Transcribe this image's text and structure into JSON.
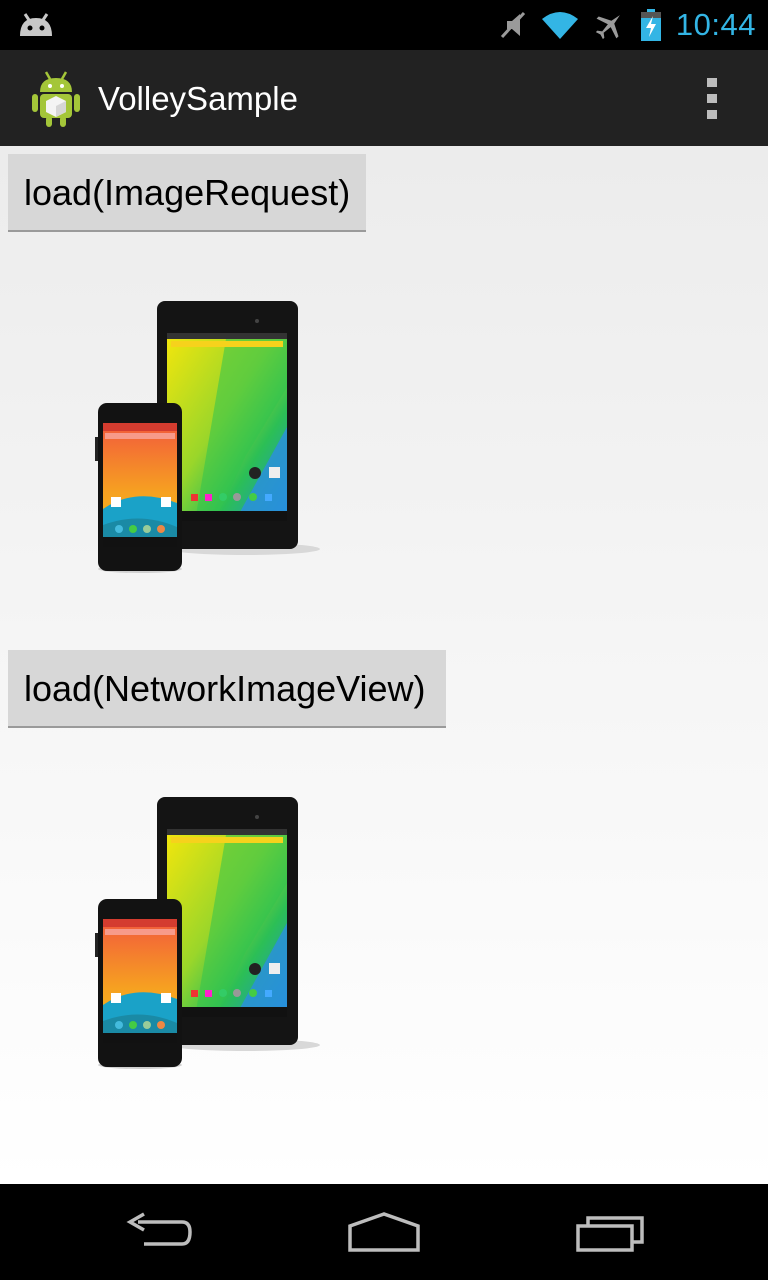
{
  "status_bar": {
    "time": "10:44",
    "icons": [
      "android-notification-icon",
      "mute-icon",
      "wifi-icon",
      "airplane-mode-icon",
      "battery-charging-icon"
    ]
  },
  "action_bar": {
    "title": "VolleySample",
    "app_icon": "android-robot-icon",
    "overflow_icon": "overflow-menu-icon"
  },
  "content": {
    "buttons": [
      {
        "label": "load(ImageRequest)"
      },
      {
        "label": "load(NetworkImageView)"
      }
    ],
    "images": [
      {
        "icon": "nexus-devices-image"
      },
      {
        "icon": "nexus-devices-image"
      }
    ]
  },
  "nav_bar": {
    "icons": [
      "back-icon",
      "home-icon",
      "recent-apps-icon"
    ]
  },
  "colors": {
    "clock": "#33b5e5",
    "action_bar": "#222222",
    "button": "#d7d7d7"
  }
}
